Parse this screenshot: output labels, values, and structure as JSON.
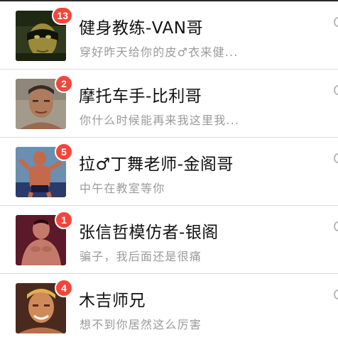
{
  "chats": [
    {
      "name": "健身教练-VAN哥",
      "preview": "穿好昨天给你的皮♂衣来健...",
      "unread": "13",
      "avatar_icon": "avatar-masked-man-icon",
      "colors": {
        "bg": "#2f3a1e",
        "skin": "#9b8a3a",
        "accent": "#0f140a"
      }
    },
    {
      "name": "摩托车手-比利哥",
      "preview": "你什么时候能再来我这里我...",
      "unread": "2",
      "avatar_icon": "avatar-man-portrait-icon",
      "colors": {
        "bg": "#a39a8c",
        "skin": "#b07a5c",
        "accent": "#3a2a20"
      }
    },
    {
      "name": "拉♂丁舞老师-金阁哥",
      "preview": "中午在教室等你",
      "unread": "5",
      "avatar_icon": "avatar-dancer-icon",
      "colors": {
        "bg": "#6a8fb0",
        "skin": "#c46a4a",
        "accent": "#2a3a6a"
      }
    },
    {
      "name": "张信哲模仿者-银阁",
      "preview": "骗子，我后面还是很痛",
      "unread": "1",
      "avatar_icon": "avatar-shirtless-man-icon",
      "colors": {
        "bg": "#5a1a2a",
        "skin": "#c47a6a",
        "accent": "#2a0a12"
      }
    },
    {
      "name": "木吉师兄",
      "preview": "想不到你居然这么厉害",
      "unread": "4",
      "avatar_icon": "avatar-blond-man-icon",
      "colors": {
        "bg": "#4a2a1e",
        "skin": "#d08a5a",
        "accent": "#e0b050"
      }
    }
  ],
  "theme": {
    "badge_color": "#f2463c",
    "name_color": "#111111",
    "preview_color": "#9a9a9a",
    "divider_color": "#dcdcdc"
  }
}
